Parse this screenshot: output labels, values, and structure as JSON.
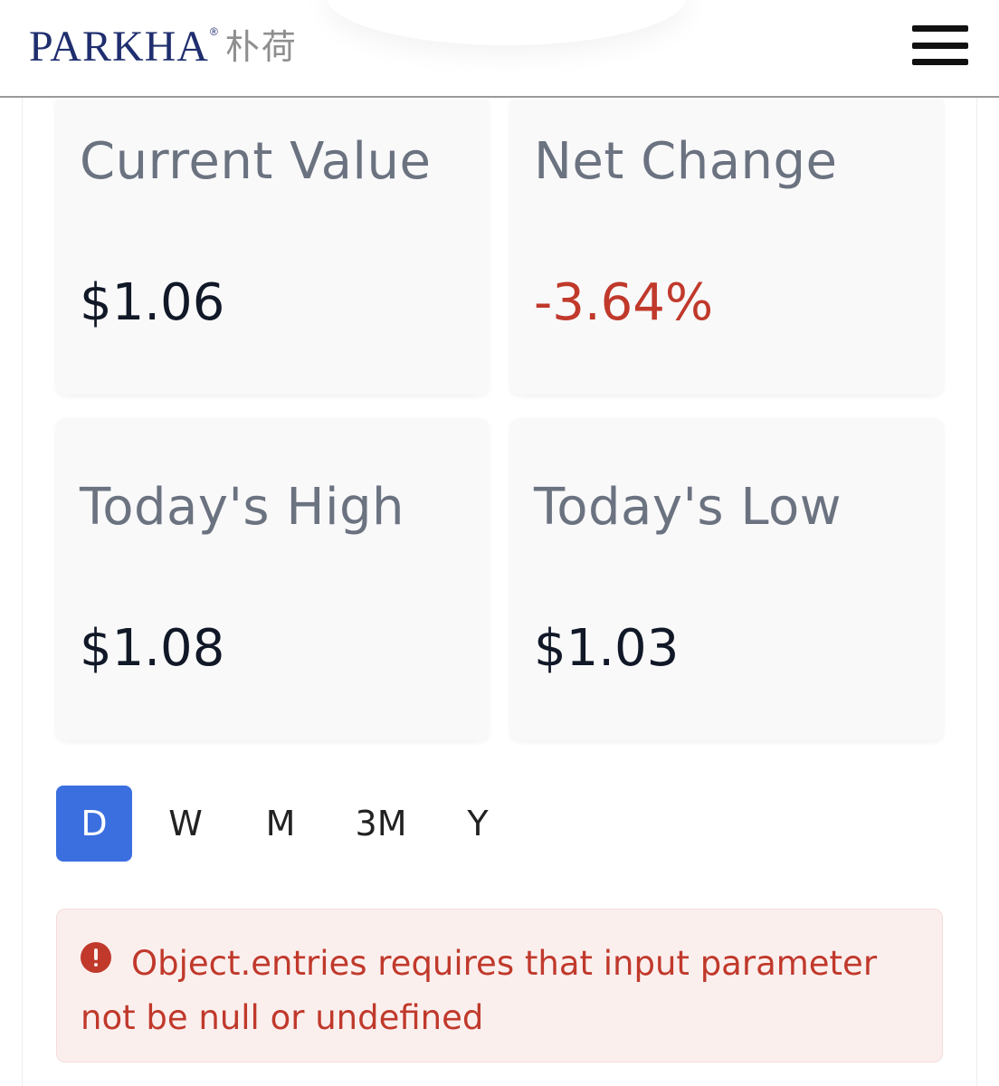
{
  "header": {
    "brand": "PARKHA",
    "brand_mark": "®",
    "brand_cn": "朴荷",
    "brand_color": "#1f2e6e",
    "menu_icon": "hamburger-menu-icon"
  },
  "stats": {
    "current_value": {
      "label": "Current Value",
      "value": "$1.06"
    },
    "net_change": {
      "label": "Net Change",
      "value": "-3.64%",
      "color": "#c0392b"
    },
    "todays_high": {
      "label": "Today's High",
      "value": "$1.08"
    },
    "todays_low": {
      "label": "Today's Low",
      "value": "$1.03"
    }
  },
  "range_tabs": {
    "items": [
      "D",
      "W",
      "M",
      "3M",
      "Y"
    ],
    "selected": "D",
    "active_color": "#3b6fe0"
  },
  "error": {
    "icon": "exclamation-circle-icon",
    "message": "Object.entries requires that input parameter not be null or undefined",
    "color": "#c0392b"
  }
}
